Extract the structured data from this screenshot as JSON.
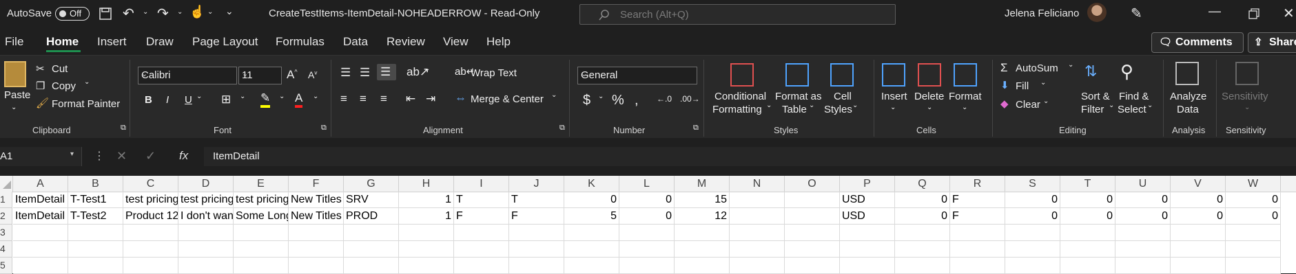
{
  "titlebar": {
    "autosave_label": "AutoSave",
    "autosave_state": "Off",
    "doc_title": "CreateTestItems-ItemDetail-NOHEADERROW  -  Read-Only",
    "search_placeholder": "Search (Alt+Q)",
    "user_name": "Jelena Feliciano"
  },
  "menu": {
    "tabs": [
      "File",
      "Home",
      "Insert",
      "Draw",
      "Page Layout",
      "Formulas",
      "Data",
      "Review",
      "View",
      "Help"
    ],
    "active": "Home",
    "comments_label": "Comments",
    "share_label": "Share"
  },
  "ribbon": {
    "clipboard": {
      "paste": "Paste",
      "cut": "Cut",
      "copy": "Copy",
      "format_painter": "Format Painter",
      "label": "Clipboard"
    },
    "font": {
      "name": "Calibri",
      "size": "11",
      "label": "Font"
    },
    "alignment": {
      "wrap": "Wrap Text",
      "merge": "Merge & Center",
      "label": "Alignment"
    },
    "number": {
      "format": "General",
      "label": "Number"
    },
    "styles": {
      "cond1": "Conditional",
      "cond2": "Formatting",
      "fmt1": "Format as",
      "fmt2": "Table",
      "cell1": "Cell",
      "cell2": "Styles",
      "label": "Styles"
    },
    "cells": {
      "insert": "Insert",
      "delete": "Delete",
      "format": "Format",
      "label": "Cells"
    },
    "editing": {
      "autosum": "AutoSum",
      "fill": "Fill",
      "clear": "Clear",
      "sort1": "Sort &",
      "sort2": "Filter",
      "find1": "Find &",
      "find2": "Select",
      "label": "Editing"
    },
    "analysis": {
      "a1": "Analyze",
      "a2": "Data",
      "label": "Analysis"
    },
    "sensitivity": {
      "s1": "Sensitivity",
      "label": "Sensitivity"
    }
  },
  "formula_bar": {
    "name_box": "A1",
    "content": "ItemDetail"
  },
  "sheet": {
    "columns": [
      "A",
      "B",
      "C",
      "D",
      "E",
      "F",
      "G",
      "H",
      "I",
      "J",
      "K",
      "L",
      "M",
      "N",
      "O",
      "P",
      "Q",
      "R",
      "S",
      "T",
      "U",
      "V",
      "W"
    ],
    "row_numbers": [
      "1",
      "2",
      "3",
      "4",
      "5"
    ],
    "rows": [
      [
        "ItemDetail",
        "T-Test1",
        "test pricing",
        "test pricing",
        "test pricing",
        "New Titles",
        "SRV",
        "1",
        "T",
        "T",
        "0",
        "0",
        "15",
        "",
        "",
        "USD",
        "0",
        "F",
        "0",
        "0",
        "0",
        "0",
        "0"
      ],
      [
        "ItemDetail",
        "T-Test2",
        "Product 12",
        "I don't want",
        "Some Long",
        "New Titles",
        "PROD",
        "1",
        "F",
        "F",
        "5",
        "0",
        "12",
        "",
        "",
        "USD",
        "0",
        "F",
        "0",
        "0",
        "0",
        "0",
        "0"
      ]
    ]
  }
}
